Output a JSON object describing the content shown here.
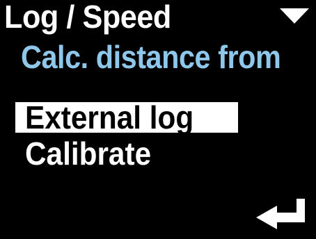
{
  "header": {
    "title": "Log / Speed",
    "subtitle": "Calc. distance from"
  },
  "menu": {
    "items": [
      {
        "label": "External log",
        "selected": true
      },
      {
        "label": "Calibrate",
        "selected": false
      }
    ]
  },
  "icons": {
    "scroll": "scroll-down-triangle-icon",
    "enter": "enter-return-icon"
  },
  "colors": {
    "background": "#000000",
    "title": "#ffffff",
    "subtitle": "#8fc7ea",
    "selected_background": "#ffffff",
    "selected_text": "#000000",
    "item_text": "#ffffff"
  }
}
